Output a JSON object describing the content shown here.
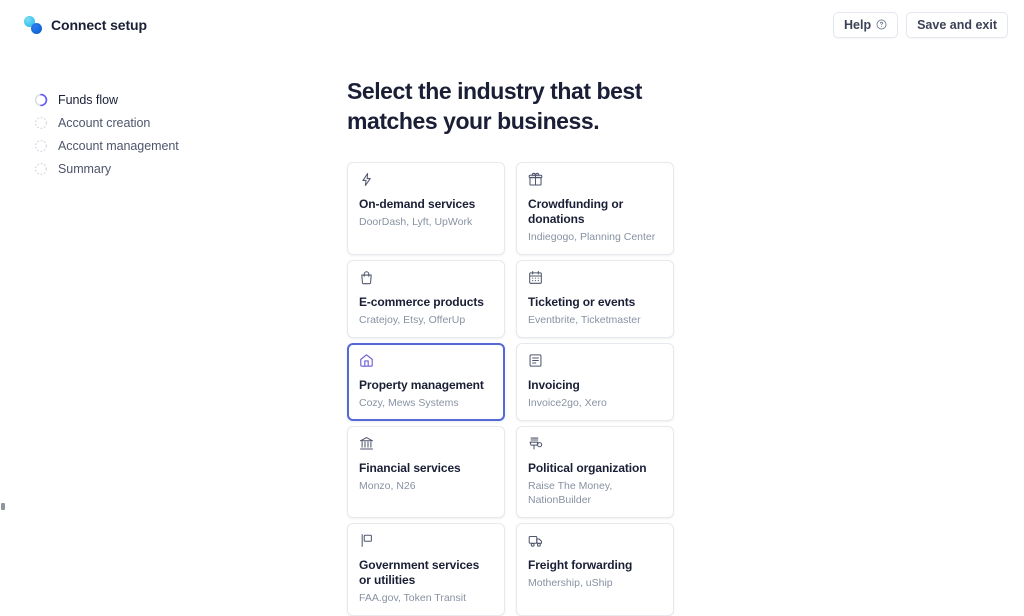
{
  "header": {
    "brand_title": "Connect setup",
    "logo_icon": "stripe-connect-logo",
    "help_label": "Help",
    "help_icon": "question-circle-icon",
    "save_label": "Save and exit"
  },
  "sidebar": {
    "items": [
      {
        "label": "Funds flow",
        "state": "active",
        "icon": "progress-ring-icon"
      },
      {
        "label": "Account creation",
        "state": "pending",
        "icon": "dotted-circle-icon"
      },
      {
        "label": "Account management",
        "state": "pending",
        "icon": "dotted-circle-icon"
      },
      {
        "label": "Summary",
        "state": "pending",
        "icon": "dotted-circle-icon"
      }
    ]
  },
  "main": {
    "title": "Select the industry that best matches your business.",
    "cards": [
      {
        "title": "On-demand services",
        "examples": "DoorDash, Lyft, UpWork",
        "icon": "lightning-bolt-icon",
        "selected": false
      },
      {
        "title": "Crowdfunding or donations",
        "examples": "Indiegogo, Planning Center",
        "icon": "gift-box-icon",
        "selected": false
      },
      {
        "title": "E-commerce products",
        "examples": "Cratejoy, Etsy, OfferUp",
        "icon": "shopping-bag-icon",
        "selected": false
      },
      {
        "title": "Ticketing or events",
        "examples": "Eventbrite, Ticketmaster",
        "icon": "calendar-icon",
        "selected": false
      },
      {
        "title": "Property management",
        "examples": "Cozy, Mews Systems",
        "icon": "house-icon",
        "selected": true
      },
      {
        "title": "Invoicing",
        "examples": "Invoice2go, Xero",
        "icon": "invoice-document-icon",
        "selected": false
      },
      {
        "title": "Financial services",
        "examples": "Monzo, N26",
        "icon": "bank-icon",
        "selected": false
      },
      {
        "title": "Political organization",
        "examples": "Raise The Money, NationBuilder",
        "icon": "podium-icon",
        "selected": false
      },
      {
        "title": "Government services or utilities",
        "examples": "FAA.gov, Token Transit",
        "icon": "flag-icon",
        "selected": false
      },
      {
        "title": "Freight forwarding",
        "examples": "Mothership, uShip",
        "icon": "truck-icon",
        "selected": false
      }
    ]
  },
  "colors": {
    "accent_selected_border": "#5469d4",
    "accent_icon_purple": "#6c5dd3",
    "progress_ring": "#635bff",
    "text_primary": "#1a1f36",
    "text_muted": "#8792a2",
    "card_border": "#e6e9ee"
  }
}
